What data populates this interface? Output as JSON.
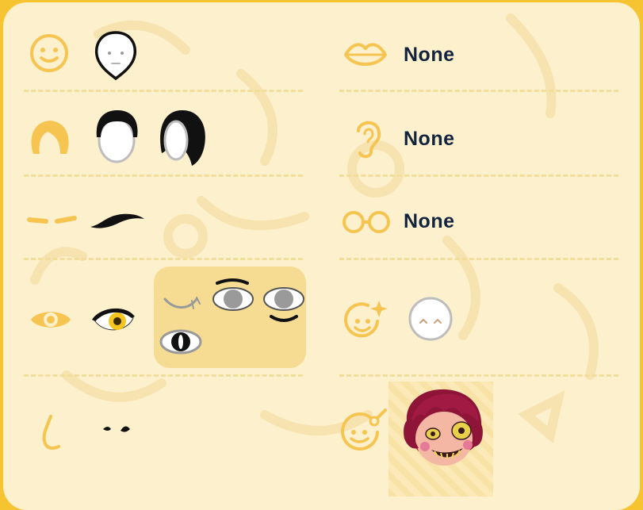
{
  "rows_left": [
    {
      "category": "face",
      "icon": "face-shape-icon",
      "options": [
        "face-option-1"
      ]
    },
    {
      "category": "hair",
      "icon": "hair-icon",
      "options": [
        "hair-option-short",
        "hair-option-long"
      ]
    },
    {
      "category": "eyebrows",
      "icon": "eyebrows-icon",
      "options": [
        "eyebrows-option-1"
      ]
    },
    {
      "category": "eyes",
      "icon": "eye-icon",
      "options": [
        "eyes-option-1",
        "eyes-option-wink",
        "eyes-option-browed",
        "eyes-option-smile",
        "eyes-option-cat"
      ]
    },
    {
      "category": "nose",
      "icon": "nose-icon",
      "options": [
        "nose-option-1"
      ]
    }
  ],
  "rows_right": [
    {
      "category": "mouth",
      "icon": "lips-icon",
      "value": "None"
    },
    {
      "category": "ears",
      "icon": "ear-icon",
      "value": "None"
    },
    {
      "category": "glasses",
      "icon": "glasses-icon",
      "value": "None"
    },
    {
      "category": "expression",
      "icon": "sparkle-face-icon",
      "options": [
        "expression-option-1"
      ]
    },
    {
      "category": "accessory",
      "icon": "pin-face-icon",
      "options": [
        "character-preview"
      ]
    }
  ],
  "colors": {
    "background": "#f7c431",
    "panel": "#fdf0cd",
    "category_icon": "#f5c451",
    "eye_highlight": "#f6dc92",
    "text": "#14233d"
  }
}
